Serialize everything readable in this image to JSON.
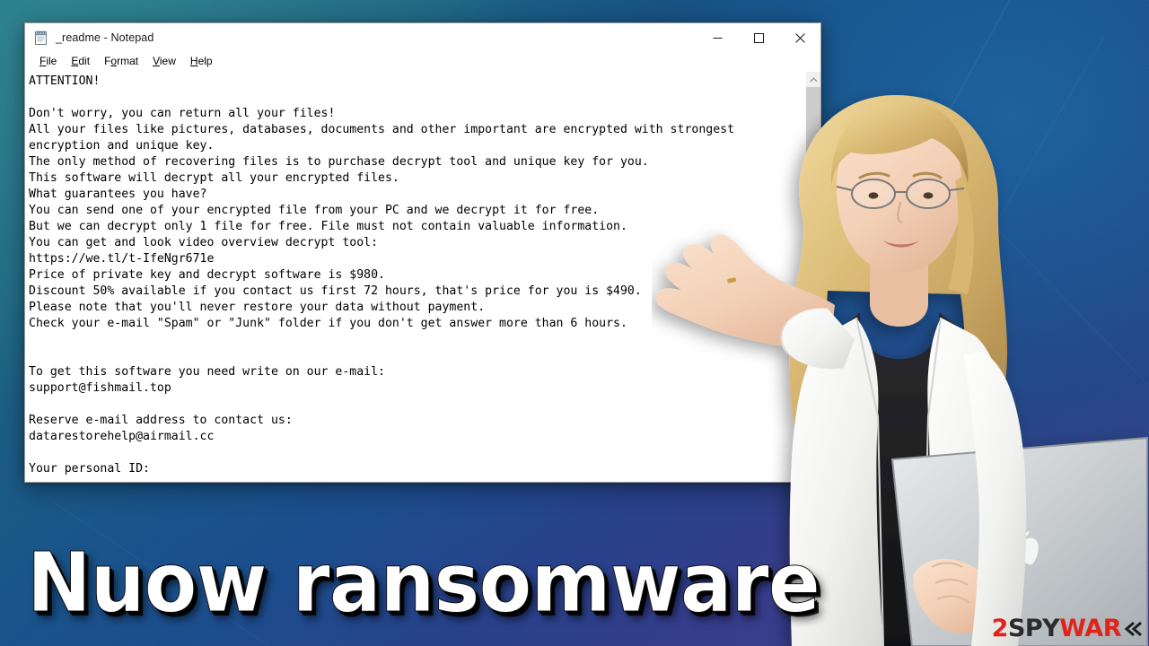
{
  "window": {
    "title": "_readme - Notepad",
    "icon": "notepad-icon",
    "menu": [
      {
        "label": "File",
        "accel": "F"
      },
      {
        "label": "Edit",
        "accel": "E"
      },
      {
        "label": "Format",
        "accel": "o"
      },
      {
        "label": "View",
        "accel": "V"
      },
      {
        "label": "Help",
        "accel": "H"
      }
    ],
    "controls": {
      "minimize": "minimize",
      "maximize": "maximize",
      "close": "close"
    },
    "scrollbar": {
      "up_arrow": "scroll-up",
      "down_arrow": "scroll-down",
      "thumb": "scroll-thumb"
    }
  },
  "note": {
    "text": "ATTENTION!\n\nDon't worry, you can return all your files!\nAll your files like pictures, databases, documents and other important are encrypted with strongest\nencryption and unique key.\nThe only method of recovering files is to purchase decrypt tool and unique key for you.\nThis software will decrypt all your encrypted files.\nWhat guarantees you have?\nYou can send one of your encrypted file from your PC and we decrypt it for free.\nBut we can decrypt only 1 file for free. File must not contain valuable information.\nYou can get and look video overview decrypt tool:\nhttps://we.tl/t-IfeNgr671e\nPrice of private key and decrypt software is $980.\nDiscount 50% available if you contact us first 72 hours, that's price for you is $490.\nPlease note that you'll never restore your data without payment.\nCheck your e-mail \"Spam\" or \"Junk\" folder if you don't get answer more than 6 hours.\n\n\nTo get this software you need write on our e-mail:\nsupport@fishmail.top\n\nReserve e-mail address to contact us:\ndatarestorehelp@airmail.cc\n\nYour personal ID:",
    "key_values": {
      "video_url": "https://we.tl/t-IfeNgr671e",
      "price": "$980",
      "discount_price": "$490",
      "discount_percent": "50%",
      "discount_window": "72 hours",
      "response_time": "6 hours",
      "primary_email": "support@fishmail.top",
      "reserve_email": "datarestorehelp@airmail.cc",
      "free_files": "1 file"
    }
  },
  "banner": {
    "title": "Nuow ransomware"
  },
  "watermark": {
    "part_2": "2",
    "part_spy": "SPY",
    "part_ware": "WAR",
    "part_e": "E"
  },
  "colors": {
    "background_teal": "#2c7f8e",
    "background_blue": "#17548a",
    "background_purple": "#3d3f8f",
    "window_bg": "#ffffff",
    "text": "#000000",
    "logo_red": "#e0241b",
    "logo_dark": "#2b2b2b",
    "scrollbar_thumb": "#cdcdcd"
  }
}
